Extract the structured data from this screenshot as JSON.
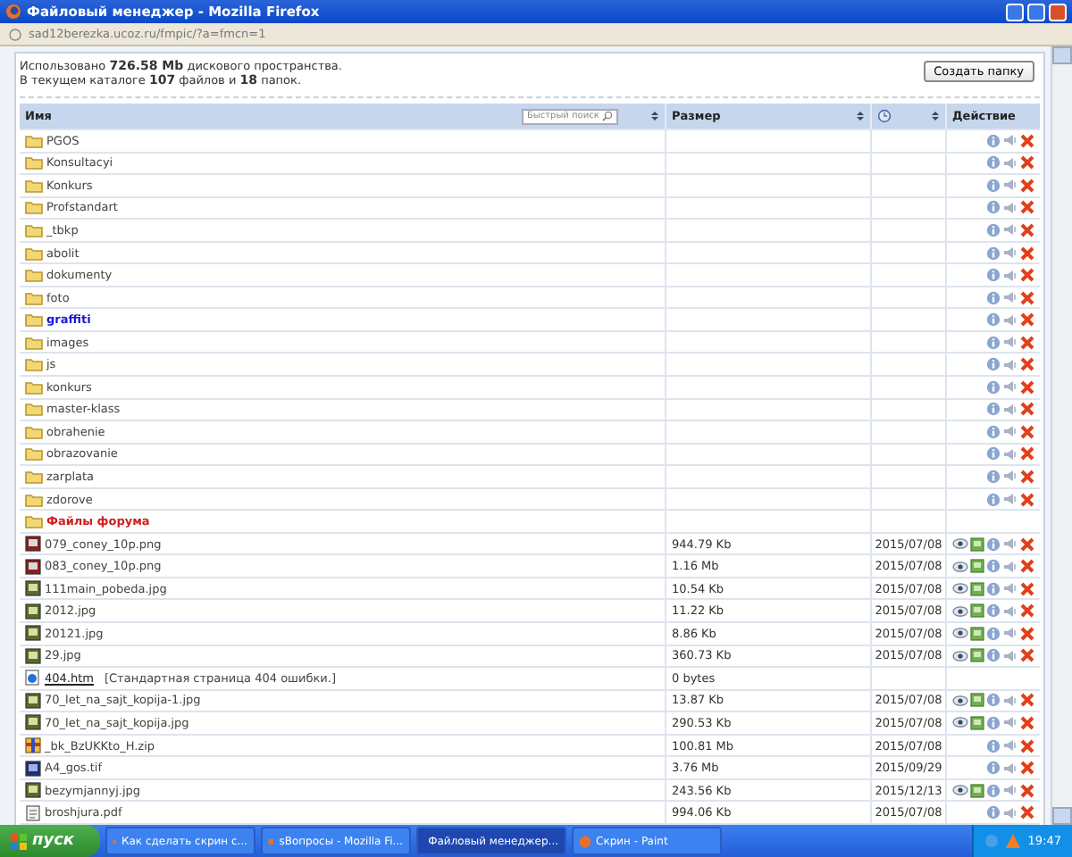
{
  "window": {
    "title": "Файловый менеджер - Mozilla Firefox"
  },
  "address_bar": {
    "url": "sad12berezka.ucoz.ru/fmpic/?a=fmcn=1"
  },
  "info": [
    "Использовано **726.58 Mb** дискового пространства.",
    "В текущем каталоге **107** файлов и **18** папок."
  ],
  "create_button": "Создать папку",
  "table": {
    "name_header": "Имя",
    "search_placeholder": "Быстрый поиск",
    "size_header": "Размер",
    "action_header": "Действие",
    "rows": [
      {
        "kind": "folder",
        "name": "PGOS",
        "actions": true,
        "preview": false
      },
      {
        "kind": "folder",
        "name": "Konsultacyi",
        "actions": true,
        "preview": false
      },
      {
        "kind": "folder",
        "name": "Konkurs",
        "actions": true,
        "preview": false
      },
      {
        "kind": "folder",
        "name": "Profstandart",
        "actions": true,
        "preview": false
      },
      {
        "kind": "folder",
        "name": "_tbkp",
        "actions": true,
        "preview": false
      },
      {
        "kind": "folder",
        "name": "abolit",
        "actions": true,
        "preview": false
      },
      {
        "kind": "folder",
        "name": "dokumenty",
        "actions": true,
        "preview": false
      },
      {
        "kind": "folder",
        "name": "foto",
        "actions": true,
        "preview": false
      },
      {
        "kind": "folder",
        "name": "graffiti",
        "color": "#1a1ad0",
        "actions": true,
        "preview": false
      },
      {
        "kind": "folder",
        "name": "images",
        "actions": true,
        "preview": false
      },
      {
        "kind": "folder",
        "name": "js",
        "actions": true,
        "preview": false
      },
      {
        "kind": "folder",
        "name": "konkurs",
        "actions": true,
        "preview": false
      },
      {
        "kind": "folder",
        "name": "master-klass",
        "actions": true,
        "preview": false
      },
      {
        "kind": "folder",
        "name": "obrahenie",
        "actions": true,
        "preview": false
      },
      {
        "kind": "folder",
        "name": "obrazovanie",
        "actions": true,
        "preview": false
      },
      {
        "kind": "folder",
        "name": "zarplata",
        "actions": true,
        "preview": false
      },
      {
        "kind": "folder",
        "name": "zdorove",
        "actions": true,
        "preview": false
      },
      {
        "kind": "folder",
        "name": "Файлы форума",
        "color": "#d02020",
        "actions": false
      },
      {
        "kind": "png",
        "name": "079_coney_10p.png",
        "size": "944.79 Kb",
        "date": "2015/07/08",
        "actions": true,
        "preview": true
      },
      {
        "kind": "png",
        "name": "083_coney_10p.png",
        "size": "1.16 Mb",
        "date": "2015/07/08",
        "actions": true,
        "preview": true
      },
      {
        "kind": "jpg",
        "name": "111main_pobeda.jpg",
        "size": "10.54 Kb",
        "date": "2015/07/08",
        "actions": true,
        "preview": true
      },
      {
        "kind": "jpg",
        "name": "2012.jpg",
        "size": "11.22 Kb",
        "date": "2015/07/08",
        "actions": true,
        "preview": true
      },
      {
        "kind": "jpg",
        "name": "20121.jpg",
        "size": "8.86 Kb",
        "date": "2015/07/08",
        "actions": true,
        "preview": true
      },
      {
        "kind": "jpg",
        "name": "29.jpg",
        "size": "360.73 Kb",
        "date": "2015/07/08",
        "actions": true,
        "preview": true
      },
      {
        "kind": "htm",
        "name": "404.htm",
        "note": "[Стандартная страница 404 ошибки.]",
        "size": "0 bytes",
        "actions": false
      },
      {
        "kind": "jpg",
        "name": "70_let_na_sajt_kopija-1.jpg",
        "size": "13.87 Kb",
        "date": "2015/07/08",
        "actions": true,
        "preview": true
      },
      {
        "kind": "jpg",
        "name": "70_let_na_sajt_kopija.jpg",
        "size": "290.53 Kb",
        "date": "2015/07/08",
        "actions": true,
        "preview": true
      },
      {
        "kind": "zip",
        "name": "_bk_BzUKKto_H.zip",
        "size": "100.81 Mb",
        "date": "2015/07/08",
        "actions": true,
        "preview": false
      },
      {
        "kind": "tif",
        "name": "A4_gos.tif",
        "size": "3.76 Mb",
        "date": "2015/09/29",
        "actions": true,
        "preview": false
      },
      {
        "kind": "jpg",
        "name": "bezymjannyj.jpg",
        "size": "243.56 Kb",
        "date": "2015/12/13",
        "actions": true,
        "preview": true
      },
      {
        "kind": "pdf",
        "name": "broshjura.pdf",
        "size": "994.06 Kb",
        "date": "2015/07/08",
        "actions": true,
        "preview": false
      }
    ]
  },
  "taskbar": {
    "start": "пуск",
    "tasks": [
      {
        "label": "Как сделать скрин с...",
        "selected": false
      },
      {
        "label": "sВопросы - Mozilla Fi...",
        "selected": false
      },
      {
        "label": "Файловый менеджер...",
        "selected": true
      },
      {
        "label": "Скрин - Paint",
        "selected": false
      }
    ],
    "clock": "19:47"
  }
}
